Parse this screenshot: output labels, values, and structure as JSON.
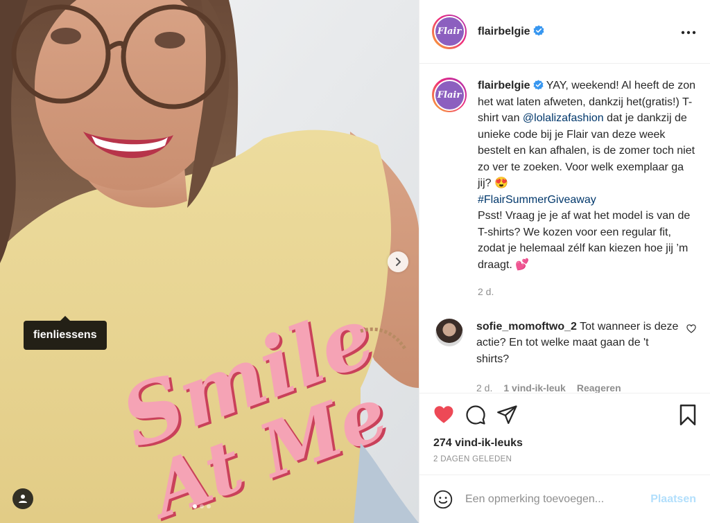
{
  "photo": {
    "tag_label": "fienliessens",
    "shirt_text_line1": "Smile",
    "shirt_text_line2": "At Me",
    "carousel_count": 3,
    "carousel_active": 0
  },
  "header": {
    "avatar_text": "Flair",
    "username": "flairbelgie",
    "verified": true
  },
  "caption": {
    "username": "flairbelgie",
    "text_1": " YAY, weekend! Al heeft de zon het wat laten afweten, dankzij het(gratis!) T-shirt van ",
    "mention": "@lolalizafashion",
    "text_2": " dat je dankzij de unieke code bij je Flair van deze week bestelt en kan afhalen, is de zomer toch niet zo ver te zoeken. Voor welk exemplaar ga jij? 😍",
    "hashtag": "#FlairSummerGiveaway",
    "text_3": "Psst! Vraag je je af wat het model is van de T-shirts? We kozen voor een regular fit, zodat je helemaal zélf kan kiezen hoe jij ’m draagt. 💕",
    "time": "2 d."
  },
  "comment": {
    "username": "sofie_momoftwo_2",
    "text": " Tot wanneer is deze actie? En tot welke maat gaan de 't shirts?",
    "time": "2 d.",
    "likes": "1 vind-ik-leuk",
    "reply": "Reageren"
  },
  "actions": {
    "liked": true,
    "likes_count": "274 vind-ik-leuks",
    "date": "2 DAGEN GELEDEN"
  },
  "add_comment": {
    "placeholder": "Een opmerking toevoegen...",
    "post_label": "Plaatsen"
  },
  "colors": {
    "like_red": "#ed4956",
    "link_blue": "#00376b",
    "verified_blue": "#3897f0",
    "post_disabled": "#b2dffc",
    "shirt_yellow": "#e9d79a",
    "shirt_text_pink": "#f5a3b5"
  }
}
